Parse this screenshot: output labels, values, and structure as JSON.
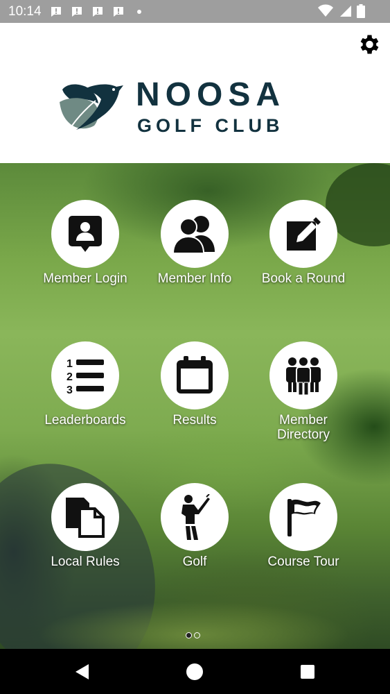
{
  "status_bar": {
    "time": "10:14",
    "notifications": [
      "alert-icon",
      "alert-icon",
      "alert-icon",
      "alert-icon"
    ],
    "icons": [
      "wifi-icon",
      "signal-icon",
      "battery-icon"
    ]
  },
  "header": {
    "logo_title": "NOOSA",
    "logo_subtitle": "GOLF CLUB",
    "settings_icon": "gear-icon",
    "colors": {
      "logo": "#12323f",
      "bird_light": "#6f8a84",
      "bird_dark": "#12323f"
    }
  },
  "tiles": [
    {
      "label": "Member Login",
      "icon": "member-login-icon"
    },
    {
      "label": "Member Info",
      "icon": "member-info-icon"
    },
    {
      "label": "Book a Round",
      "icon": "edit-icon"
    },
    {
      "label": "Leaderboards",
      "icon": "numbered-list-icon"
    },
    {
      "label": "Results",
      "icon": "calendar-icon"
    },
    {
      "label": "Member Directory",
      "icon": "group-icon"
    },
    {
      "label": "Local Rules",
      "icon": "documents-icon"
    },
    {
      "label": "Golf",
      "icon": "golfer-icon"
    },
    {
      "label": "Course Tour",
      "icon": "flag-icon"
    }
  ],
  "pager": {
    "pages": 2,
    "current": 1
  },
  "navbar": {
    "buttons": [
      "back-icon",
      "home-icon",
      "recents-icon"
    ]
  }
}
